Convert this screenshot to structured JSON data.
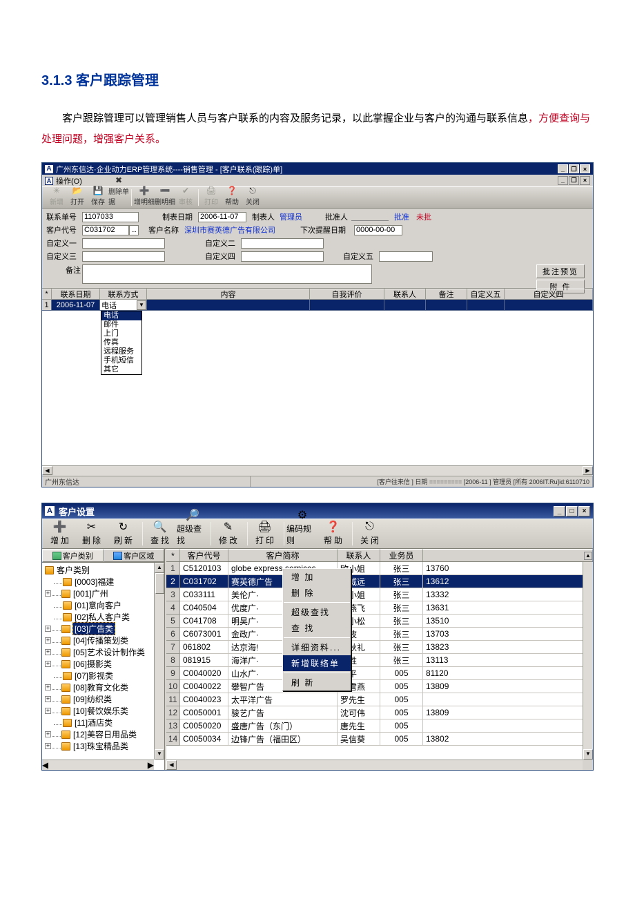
{
  "doc": {
    "heading": "3.1.3 客户跟踪管理",
    "para_prefix": "客户跟踪管理可以管理销售人员与客户联系的内容及服务记录，以此掌握企业与客户的沟通与联系信息",
    "para_red": "，方便查询与处理问题，增强客户关系。"
  },
  "win1": {
    "title": "广州东信达·企业动力ERP管理系统----销售管理 - [客户联系(跟踪)单]",
    "menu": [
      "操作(O)"
    ],
    "toolbar": [
      {
        "label": "新增",
        "icon": "✳",
        "disabled": true
      },
      {
        "label": "打开",
        "icon": "📂"
      },
      {
        "label": "保存",
        "icon": "💾"
      },
      {
        "label": "删除单据",
        "icon": "✖"
      },
      {
        "sep": true
      },
      {
        "label": "增明细",
        "icon": "➕"
      },
      {
        "label": "删明细",
        "icon": "➖"
      },
      {
        "label": "审核",
        "icon": "✔",
        "disabled": true
      },
      {
        "sep": true
      },
      {
        "label": "打印",
        "icon": "🖨",
        "disabled": true
      },
      {
        "label": "帮助",
        "icon": "❓"
      },
      {
        "label": "关闭",
        "icon": "⎋"
      }
    ],
    "form": {
      "contact_no_label": "联系单号",
      "contact_no": "1107033",
      "create_date_label": "制表日期",
      "create_date": "2006-11-07",
      "creator_label": "制表人",
      "creator": "管理员",
      "approver_label": "批准人",
      "approver": "",
      "approve_link": "批准",
      "unapprove_link": "未批",
      "cust_code_label": "客户代号",
      "cust_code": "C031702",
      "cust_name_label": "客户名称",
      "cust_name": "深圳市赛英德广告有限公司",
      "next_date_label": "下次提醒日期",
      "next_date": "0000-00-00",
      "c1_label": "自定义一",
      "c2_label": "自定义二",
      "c3_label": "自定义三",
      "c4_label": "自定义四",
      "c5_label": "自定义五",
      "remark_label": "备注",
      "btn_preview": "批注预览",
      "btn_attach": "附 件"
    },
    "grid_head": [
      "*",
      "联系日期",
      "联系方式",
      "内容",
      "自我评价",
      "联系人",
      "备注",
      "自定义五",
      "自定义四"
    ],
    "grid_row": {
      "n": "1",
      "date": "2006-11-07",
      "method": "电话"
    },
    "combo_options": [
      "电话",
      "邮件",
      "上门",
      "传真",
      "远程服务",
      "手机短信",
      "其它"
    ],
    "status_left": "广州东信达",
    "status_right": "[客户往来信 ] 日期 ========= [2006-11 ] 管理员 [所有 2006IT.Ru]id:6110710"
  },
  "win2": {
    "title": "客户设置",
    "toolbar": [
      {
        "label": "增加",
        "icon": "➕"
      },
      {
        "label": "删除",
        "icon": "✂"
      },
      {
        "label": "刷新",
        "icon": "↻"
      },
      {
        "sep": true
      },
      {
        "label": "查找",
        "icon": "🔍"
      },
      {
        "label": "超级查找",
        "icon": "🔎",
        "compact": true
      },
      {
        "sep": true
      },
      {
        "label": "修改",
        "icon": "✎"
      },
      {
        "sep": true
      },
      {
        "label": "打印",
        "icon": "🖨"
      },
      {
        "sep": true
      },
      {
        "label": "编码规则",
        "icon": "⚙",
        "compact": true
      },
      {
        "label": "帮助",
        "icon": "❓"
      },
      {
        "sep": true
      },
      {
        "label": "关闭",
        "icon": "⎋"
      }
    ],
    "tabs": [
      "客户类别",
      "客户区域"
    ],
    "tree_root": "客户类别",
    "tree_items": [
      {
        "label": "[0003]福建",
        "sp": 1
      },
      {
        "label": "[001]广州",
        "pm": "+"
      },
      {
        "label": "[01]意向客户",
        "sp": 1
      },
      {
        "label": "[02]私人客户类",
        "sp": 1
      },
      {
        "label": "[03]广告类",
        "pm": "+",
        "sel": true
      },
      {
        "label": "[04]传播策划类",
        "pm": "+"
      },
      {
        "label": "[05]艺术设计制作类",
        "pm": "+"
      },
      {
        "label": "[06]摄影类",
        "pm": "+"
      },
      {
        "label": "[07]影视类",
        "sp": 1
      },
      {
        "label": "[08]教育文化类",
        "pm": "+"
      },
      {
        "label": "[09]纺织类",
        "pm": "+"
      },
      {
        "label": "[10]餐饮娱乐类",
        "pm": "+"
      },
      {
        "label": "[11]酒店类",
        "sp": 1
      },
      {
        "label": "[12]美容日用品类",
        "pm": "+"
      },
      {
        "label": "[13]珠宝精品类",
        "pm": "+"
      }
    ],
    "grid_head": [
      "*",
      "客户代号",
      "客户简称",
      "联系人",
      "业务员",
      ""
    ],
    "rows": [
      {
        "n": "1",
        "code": "C5120103",
        "name": "globe express sernices",
        "contact": "欧小姐",
        "sales": "张三",
        "ext": "13760"
      },
      {
        "n": "2",
        "code": "C031702",
        "name": "赛英德广告",
        "contact": "方威远",
        "sales": "张三",
        "ext": "13612",
        "sel": true
      },
      {
        "n": "3",
        "code": "C033111",
        "name": "美伦广·",
        "contact": "贾小姐",
        "sales": "张三",
        "ext": "13332"
      },
      {
        "n": "4",
        "code": "C040504",
        "name": "优度广·",
        "contact": "梁燕飞",
        "sales": "张三",
        "ext": "13631"
      },
      {
        "n": "5",
        "code": "C041708",
        "name": "明昊广·",
        "contact": "彭小松",
        "sales": "张三",
        "ext": "13510"
      },
      {
        "n": "6",
        "code": "C6073001",
        "name": "金政广·",
        "contact": "石波",
        "sales": "张三",
        "ext": "13703"
      },
      {
        "n": "7",
        "code": "061802",
        "name": "达京海!",
        "contact": "周秋礼",
        "sales": "张三",
        "ext": "13823"
      },
      {
        "n": "8",
        "code": "081915",
        "name": "海洋广·",
        "contact": "桂胜",
        "sales": "张三",
        "ext": "13113"
      },
      {
        "n": "9",
        "code": "C0040020",
        "name": "山水广·",
        "contact": "李平",
        "sales": "005",
        "ext": "81120"
      },
      {
        "n": "10",
        "code": "C0040022",
        "name": "攀智广告",
        "contact": "涂雪燕",
        "sales": "005",
        "ext": "13809"
      },
      {
        "n": "11",
        "code": "C0040023",
        "name": "太平洋广告",
        "contact": "罗先生",
        "sales": "005",
        "ext": ""
      },
      {
        "n": "12",
        "code": "C0050001",
        "name": "骏艺广告",
        "contact": "沈可伟",
        "sales": "005",
        "ext": "13809"
      },
      {
        "n": "13",
        "code": "C0050020",
        "name": "盛唐广告（东门）",
        "contact": "唐先生",
        "sales": "005",
        "ext": ""
      },
      {
        "n": "14",
        "code": "C0050034",
        "name": "边锋广告（福田区）",
        "contact": "吴信葵",
        "sales": "005",
        "ext": "13802"
      }
    ],
    "ctx_menu": [
      "增 加",
      "删 除",
      "-",
      "超级查找",
      "查 找",
      "-",
      "详细资料...",
      "新增联络单",
      "-",
      "刷 新"
    ],
    "ctx_sel": "新增联络单"
  }
}
